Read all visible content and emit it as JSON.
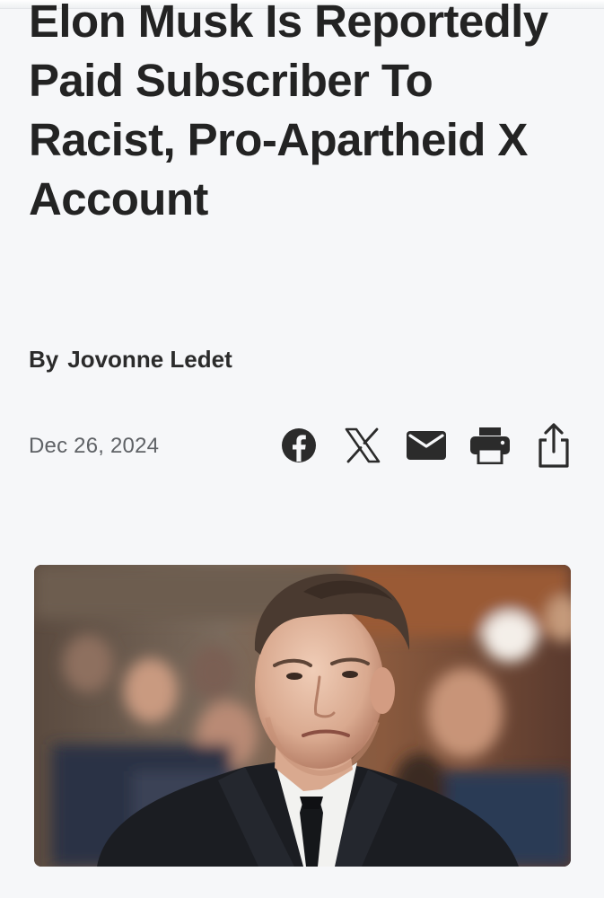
{
  "article": {
    "headline": "Elon Musk Is Reportedly Paid Subscriber To Racist, Pro-Apartheid X Account",
    "byline_prefix": "By",
    "author": "Jovonne Ledet",
    "date": "Dec 26, 2024"
  },
  "share": {
    "items": [
      {
        "icon": "facebook-icon"
      },
      {
        "icon": "x-icon"
      },
      {
        "icon": "mail-icon"
      },
      {
        "icon": "print-icon"
      },
      {
        "icon": "share-icon"
      }
    ],
    "icon_color": "#2b2b2b"
  },
  "hero_image": {
    "subject": "photo"
  },
  "colors": {
    "background": "#f6f7f9",
    "text": "#232323",
    "muted": "#5f6266"
  }
}
